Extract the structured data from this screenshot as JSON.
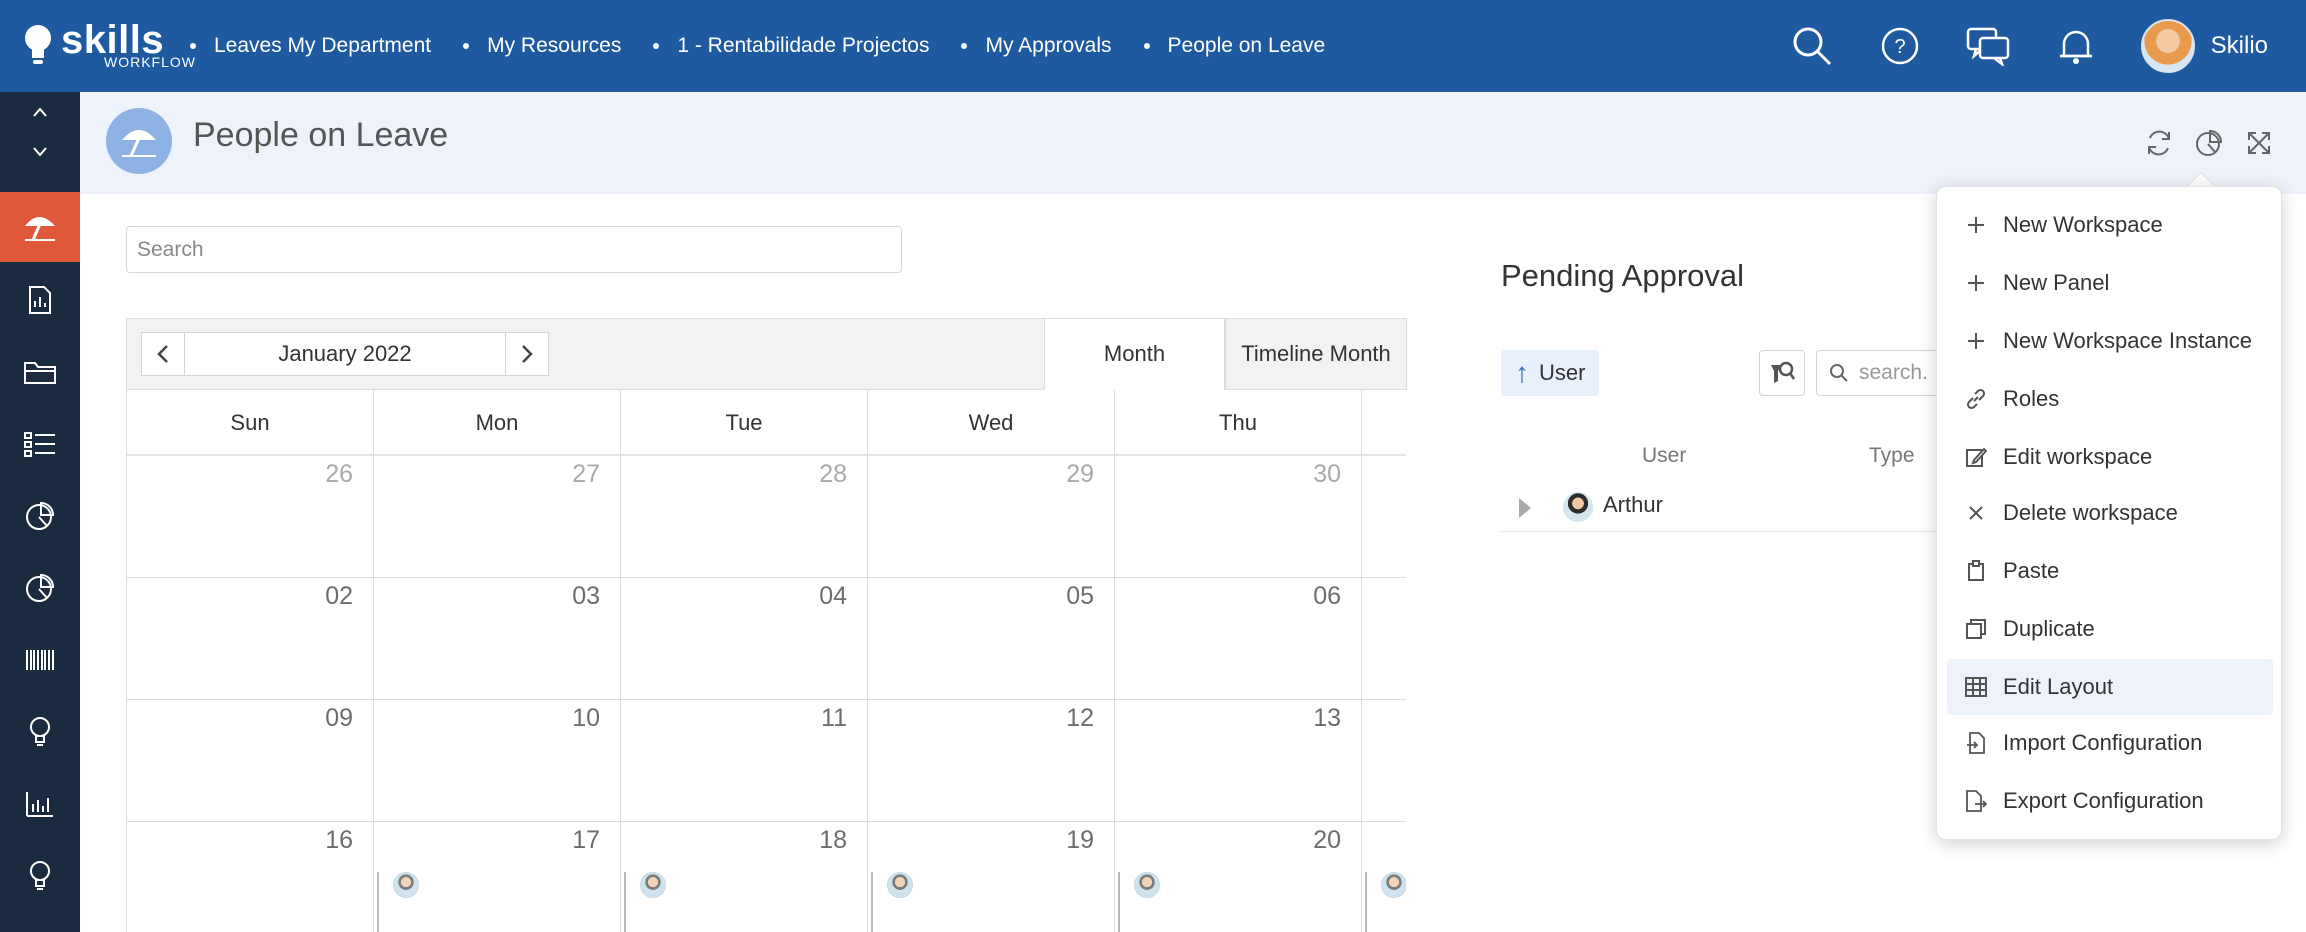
{
  "app": {
    "brand": "skills",
    "brand_sub": "WORKFLOW",
    "user_name": "Skilio"
  },
  "nav_tabs": [
    {
      "label": "Leaves My Department"
    },
    {
      "label": "My Resources"
    },
    {
      "label": "1 - Rentabilidade Projectos"
    },
    {
      "label": "My Approvals"
    },
    {
      "label": "People on Leave"
    }
  ],
  "top_icons": [
    "search-icon",
    "help-icon",
    "chat-icon",
    "bell-icon"
  ],
  "sidebar_icons": [
    "scroll-up-icon",
    "scroll-down-icon",
    "beach-umbrella-icon",
    "report-icon",
    "folder-icon",
    "list-icon",
    "pie-chart-icon",
    "pie-chart-icon",
    "barcode-icon",
    "lightbulb-icon",
    "bar-chart-icon",
    "lightbulb-icon"
  ],
  "page": {
    "title": "People on Leave",
    "header_tools": [
      "refresh-icon",
      "pie-chart-icon",
      "expand-icon"
    ]
  },
  "search": {
    "placeholder": "Search"
  },
  "calendar": {
    "month_label": "January 2022",
    "views": {
      "month": "Month",
      "timeline_month": "Timeline Month"
    },
    "weekdays": [
      "Sun",
      "Mon",
      "Tue",
      "Wed",
      "Thu"
    ],
    "weeks": [
      [
        "26",
        "27",
        "28",
        "29",
        "30"
      ],
      [
        "02",
        "03",
        "04",
        "05",
        "06"
      ],
      [
        "09",
        "10",
        "11",
        "12",
        "13"
      ],
      [
        "16",
        "17",
        "18",
        "19",
        "20"
      ]
    ]
  },
  "pending": {
    "title": "Pending Approval",
    "sort_label": "User",
    "search_placeholder": "search...",
    "col_user": "User",
    "col_type": "Type",
    "rows": [
      {
        "name": "Arthur"
      }
    ]
  },
  "menu": {
    "items": [
      {
        "label": "New Workspace",
        "icon": "plus-icon"
      },
      {
        "label": "New Panel",
        "icon": "plus-icon"
      },
      {
        "label": "New Workspace Instance",
        "icon": "plus-icon"
      },
      {
        "label": "Roles",
        "icon": "link-icon"
      },
      {
        "label": "Edit workspace",
        "icon": "edit-icon"
      },
      {
        "label": "Delete workspace",
        "icon": "close-icon"
      },
      {
        "label": "Paste",
        "icon": "clipboard-icon"
      },
      {
        "label": "Duplicate",
        "icon": "copy-icon"
      },
      {
        "label": "Edit Layout",
        "icon": "grid-icon"
      },
      {
        "label": "Import Configuration",
        "icon": "import-icon"
      },
      {
        "label": "Export Configuration",
        "icon": "export-icon"
      }
    ],
    "highlighted": "Edit Layout"
  },
  "colors": {
    "topbar": "#1f5aa0",
    "sidebar": "#1a2a3f",
    "sidebar_active": "#e0583a",
    "header_bg": "#eef3fb"
  }
}
